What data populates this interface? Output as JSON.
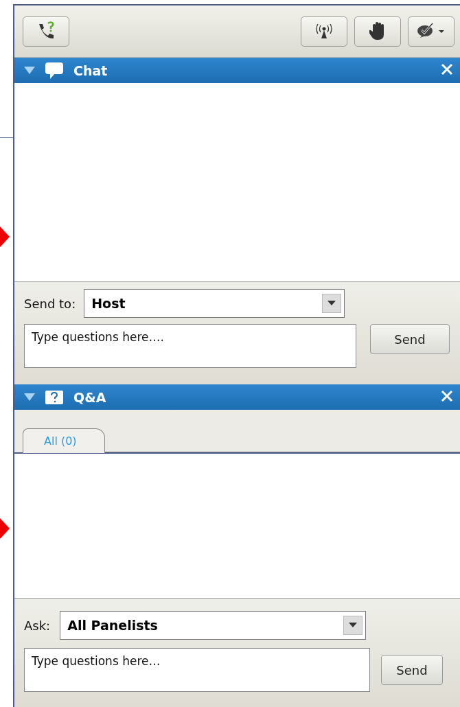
{
  "toolbar": {
    "left_buttons": [
      {
        "kind": "phone-help"
      }
    ],
    "right_buttons": [
      {
        "kind": "broadcast"
      },
      {
        "kind": "hand"
      },
      {
        "kind": "check-menu"
      }
    ]
  },
  "chat": {
    "title": "Chat",
    "expanded": true,
    "send_to": {
      "label": "Send to:",
      "value": "Host"
    },
    "message": {
      "placeholder": "Type questions here…."
    },
    "send_button": "Send"
  },
  "qa": {
    "title": "Q&A",
    "expanded": true,
    "tabs": [
      {
        "label": "All (0)",
        "selected": true
      }
    ],
    "ask": {
      "label": "Ask:",
      "value": "All Panelists"
    },
    "message": {
      "placeholder": "Type questions here…"
    },
    "send_button": "Send"
  }
}
